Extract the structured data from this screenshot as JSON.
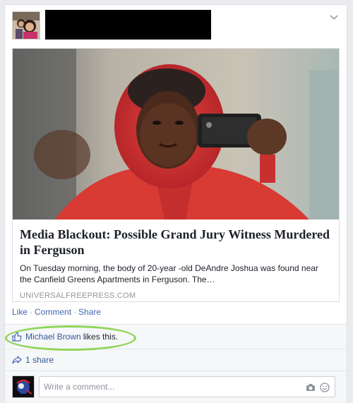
{
  "post": {
    "link": {
      "title": "Media Blackout: Possible Grand Jury Witness Murdered in Ferguson",
      "description": "On Tuesday morning, the body of 20-year -old DeAndre Joshua was found near the Canfield Greens Apartments in Ferguson. The…",
      "domain": "UNIVERSALFREEPRESS.COM"
    },
    "actions": {
      "like": "Like",
      "comment": "Comment",
      "share": "Share",
      "separator": "·"
    },
    "likes": {
      "liker": "Michael Brown",
      "suffix": "likes this."
    },
    "shares": {
      "label": "1 share"
    },
    "comment": {
      "placeholder": "Write a comment..."
    },
    "icons": {
      "menu": "chevron-down-icon",
      "like": "thumbs-up-icon",
      "share": "share-arrow-icon",
      "camera": "camera-icon",
      "emoji": "smiley-icon"
    },
    "colors": {
      "link": "#365899",
      "action": "#4267b2",
      "highlight": "#8fd65a",
      "muted": "#90949c"
    }
  }
}
